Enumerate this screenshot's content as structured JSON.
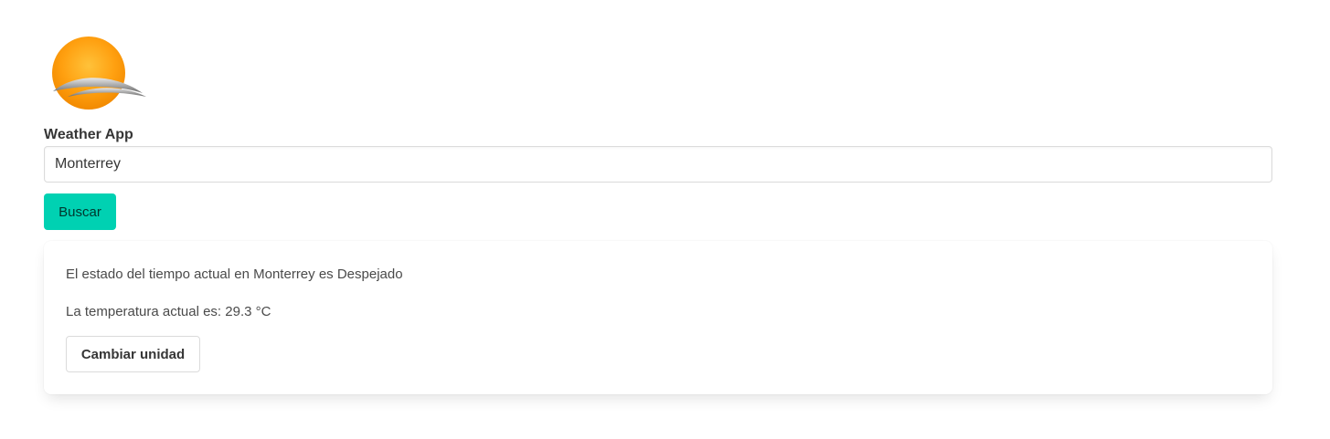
{
  "logo": {
    "icon": "sun-behind-cloud-icon",
    "colors": {
      "sun_light": "#ffb020",
      "sun_dark": "#f28a00",
      "cloud": "#9a9a9a"
    }
  },
  "form": {
    "label": "Weather App",
    "city_value": "Monterrey",
    "search_label": "Buscar"
  },
  "result": {
    "status_text": "El estado del tiempo actual en Monterrey es Despejado",
    "temperature_text": "La temperatura actual es: 29.3 °C",
    "unit_button_label": "Cambiar unidad"
  },
  "colors": {
    "accent": "#00d1b2",
    "border": "#dbdbdb",
    "text": "#363636"
  }
}
